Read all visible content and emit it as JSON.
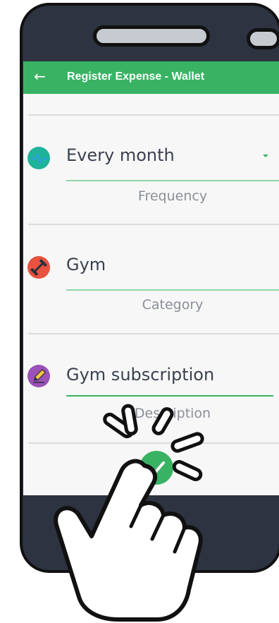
{
  "app": {
    "title": "Register Expense - Wallet",
    "back_icon": "back-arrow-icon"
  },
  "fields": [
    {
      "id": "frequency",
      "value": "Every month",
      "label": "Frequency",
      "icon": "pulse-icon",
      "icon_color": "#1fb39a",
      "has_dropdown": true
    },
    {
      "id": "category",
      "value": "Gym",
      "label": "Category",
      "icon": "dumbbell-icon",
      "icon_color": "#e8523f"
    },
    {
      "id": "description",
      "value": "Gym subscription",
      "label": "Description",
      "icon": "pencil-icon",
      "icon_color": "#9b51b7"
    }
  ],
  "save_button": {
    "icon": "checkmark-icon",
    "color": "#39b363"
  },
  "overlay": {
    "icon": "tap-hand-icon"
  }
}
